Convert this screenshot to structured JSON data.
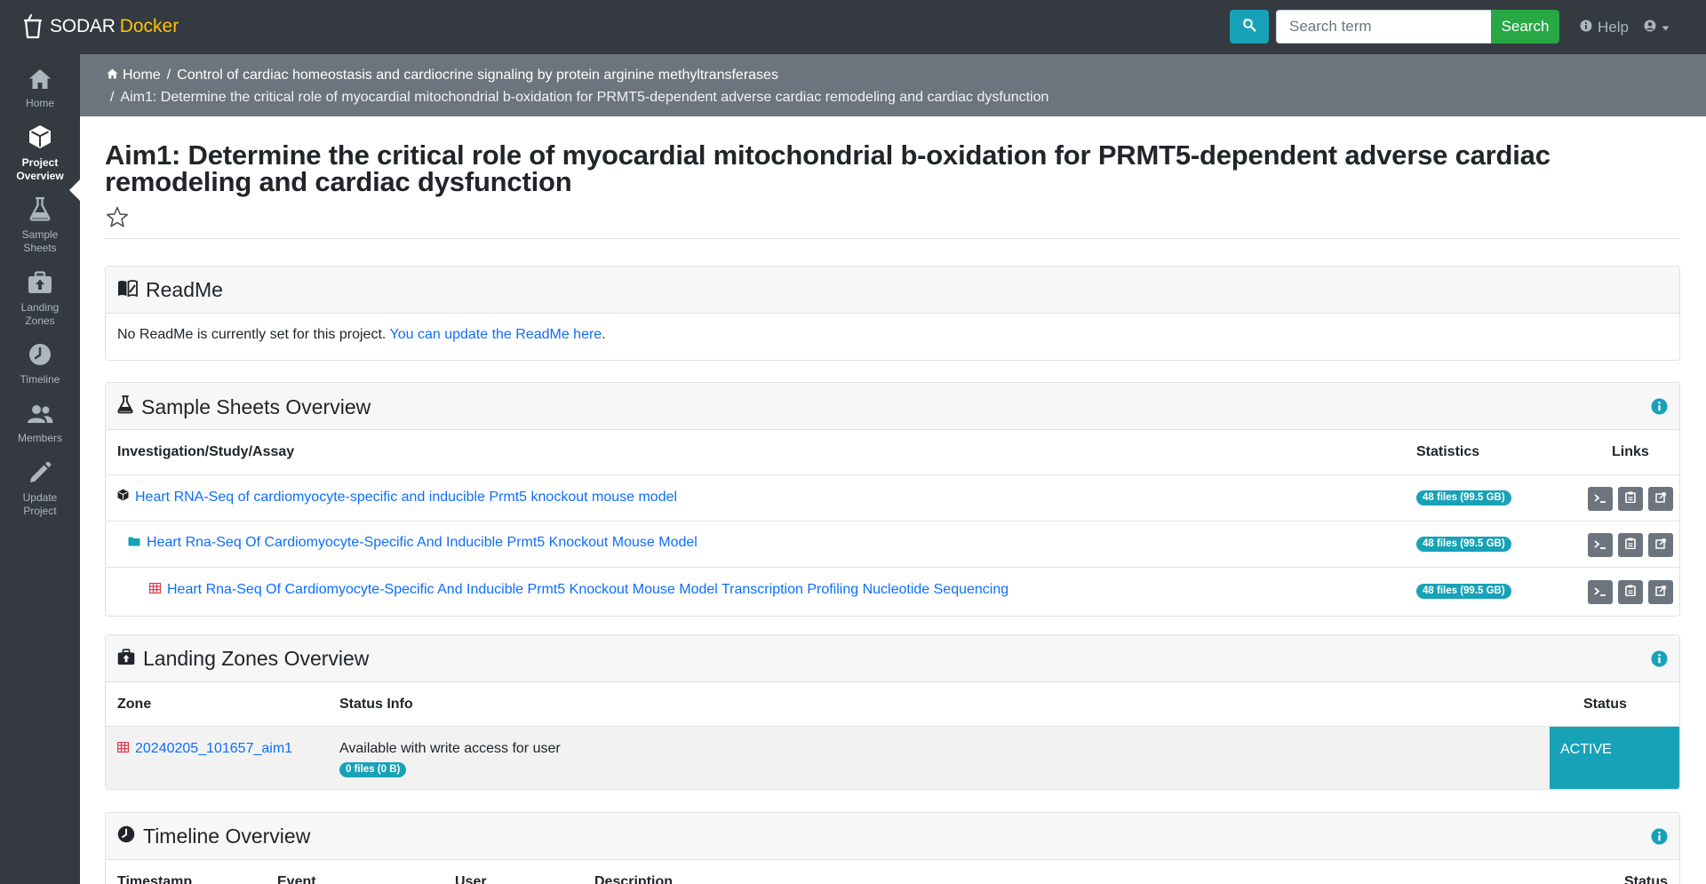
{
  "navbar": {
    "brand": "SODAR",
    "brand_accent": "Docker",
    "search_placeholder": "Search term",
    "search_button": "Search",
    "help_label": "Help",
    "advanced_search_icon": "search-advanced-icon",
    "user_icon": "user-icon",
    "colors": {
      "background": "#343a40",
      "accent": "#17a2b8",
      "search": "#28a745",
      "brand_accent": "#ffc107"
    }
  },
  "sidebar": {
    "items": [
      {
        "label": "Home",
        "icon": "home-icon",
        "active": false
      },
      {
        "label": "Project Overview",
        "icon": "cube-icon",
        "active": true
      },
      {
        "label": "Sample Sheets",
        "icon": "flask-icon",
        "active": false
      },
      {
        "label": "Landing Zones",
        "icon": "briefcase-upload-icon",
        "active": false
      },
      {
        "label": "Timeline",
        "icon": "clock-icon",
        "active": false
      },
      {
        "label": "Members",
        "icon": "members-icon",
        "active": false
      },
      {
        "label": "Update Project",
        "icon": "pencil-icon",
        "active": false
      }
    ],
    "labels": {
      "home_1": "Home",
      "overview_1": "Project",
      "overview_2": "Overview",
      "sheets_1": "Sample",
      "sheets_2": "Sheets",
      "zones_1": "Landing",
      "zones_2": "Zones",
      "timeline_1": "Timeline",
      "members_1": "Members",
      "update_1": "Update",
      "update_2": "Project"
    }
  },
  "breadcrumb": {
    "home": "Home",
    "separator": "/",
    "parent": "Control of cardiac homeostasis and cardiocrine signaling by protein arginine methyltransferases",
    "current": "Aim1: Determine the critical role of myocardial mitochondrial b-oxidation for PRMT5-dependent adverse cardiac remodeling and cardiac dysfunction"
  },
  "page": {
    "title_line1": "Aim1: Determine the critical role of myocardial mitochondrial b-oxidation for PRMT5-dependent adverse cardiac",
    "title_line2": "remodeling and cardiac dysfunction",
    "star_icon": "star-outline-icon"
  },
  "readme": {
    "title": "ReadMe",
    "icon": "book-icon",
    "text": "No ReadMe is currently set for this project.",
    "link": "You can update the ReadMe here",
    "suffix": "."
  },
  "sheets": {
    "title": "Sample Sheets Overview",
    "icon": "flask-icon",
    "columns": {
      "isa": "Investigation/Study/Assay",
      "stats": "Statistics",
      "links": "Links"
    },
    "rows": [
      {
        "type": "investigation",
        "name": "Heart RNA-Seq of cardiomyocyte-specific and inducible Prmt5 knockout mouse model",
        "stats": "48 files (99.5 GB)"
      },
      {
        "type": "study",
        "name": "Heart Rna-Seq Of Cardiomyocyte-Specific And Inducible Prmt5 Knockout Mouse Model",
        "stats": "48 files (99.5 GB)"
      },
      {
        "type": "assay",
        "name": "Heart Rna-Seq Of Cardiomyocyte-Specific And Inducible Prmt5 Knockout Mouse Model Transcription Profiling Nucleotide Sequencing",
        "stats": "48 files (99.5 GB)"
      }
    ]
  },
  "zones": {
    "title": "Landing Zones Overview",
    "icon": "briefcase-upload-icon",
    "columns": {
      "zone": "Zone",
      "info": "Status Info",
      "status": "Status"
    },
    "rows": [
      {
        "name": "20240205_101657_aim1",
        "info": "Available with write access for user",
        "files": "0 files (0 B)",
        "status": "ACTIVE"
      }
    ]
  },
  "timeline": {
    "title": "Timeline Overview",
    "icon": "clock-icon",
    "columns": {
      "timestamp": "Timestamp",
      "event": "Event",
      "user": "User",
      "description": "Description",
      "status": "Status"
    }
  }
}
